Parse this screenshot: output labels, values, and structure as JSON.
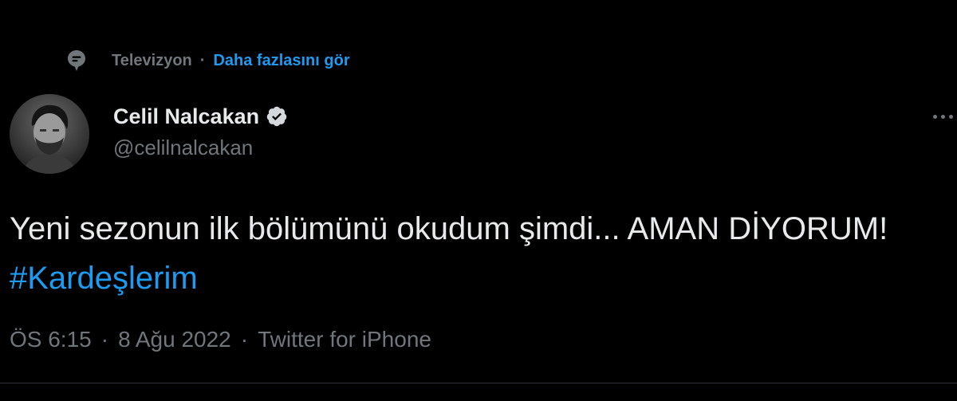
{
  "context": {
    "topic": "Televizyon",
    "separator": "·",
    "see_more": "Daha fazlasını gör"
  },
  "author": {
    "display_name": "Celil Nalcakan",
    "handle": "@celilnalcakan",
    "verified": true
  },
  "tweet": {
    "text_part1": "Yeni sezonun ilk bölümünü okudum şimdi... AMAN DİYORUM! ",
    "hashtag": "#Kardeşlerim"
  },
  "meta": {
    "time": "ÖS 6:15",
    "separator1": "·",
    "date": "8 Ağu 2022",
    "separator2": "·",
    "source": "Twitter for iPhone"
  },
  "colors": {
    "background": "#000000",
    "primary_text": "#e7e9ea",
    "secondary_text": "#71767b",
    "accent": "#1d9bf0"
  },
  "icons": {
    "topic": "topic-bubble-icon",
    "verified": "verified-badge-icon",
    "more": "more-options-icon"
  }
}
